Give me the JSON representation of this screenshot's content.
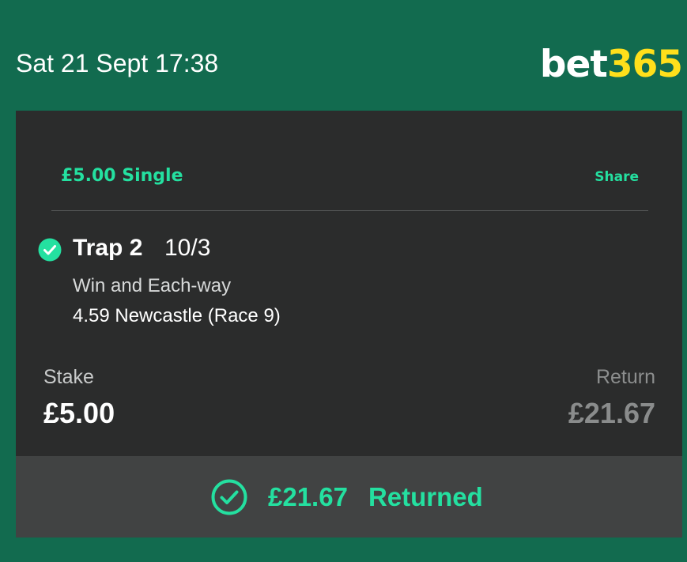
{
  "header": {
    "datetime": "Sat 21 Sept 17:38",
    "logo_bet": "bet",
    "logo_num": "365"
  },
  "bet": {
    "title": "£5.00 Single",
    "share_label": "Share",
    "selection": {
      "status_icon": "check-circle-icon",
      "name": "Trap 2",
      "odds": "10/3",
      "market": "Win and Each-way",
      "event": "4.59 Newcastle (Race 9)"
    },
    "stake_label": "Stake",
    "stake_value": "£5.00",
    "return_label": "Return",
    "return_value": "£21.67"
  },
  "footer": {
    "icon": "check-circle-outline-icon",
    "amount": "£21.67",
    "label": "Returned"
  },
  "colors": {
    "background_green": "#126b4f",
    "card_bg": "#2b2c2c",
    "footer_bg": "#414343",
    "accent_green": "#24e0a0",
    "logo_yellow": "#ffdf1b"
  }
}
